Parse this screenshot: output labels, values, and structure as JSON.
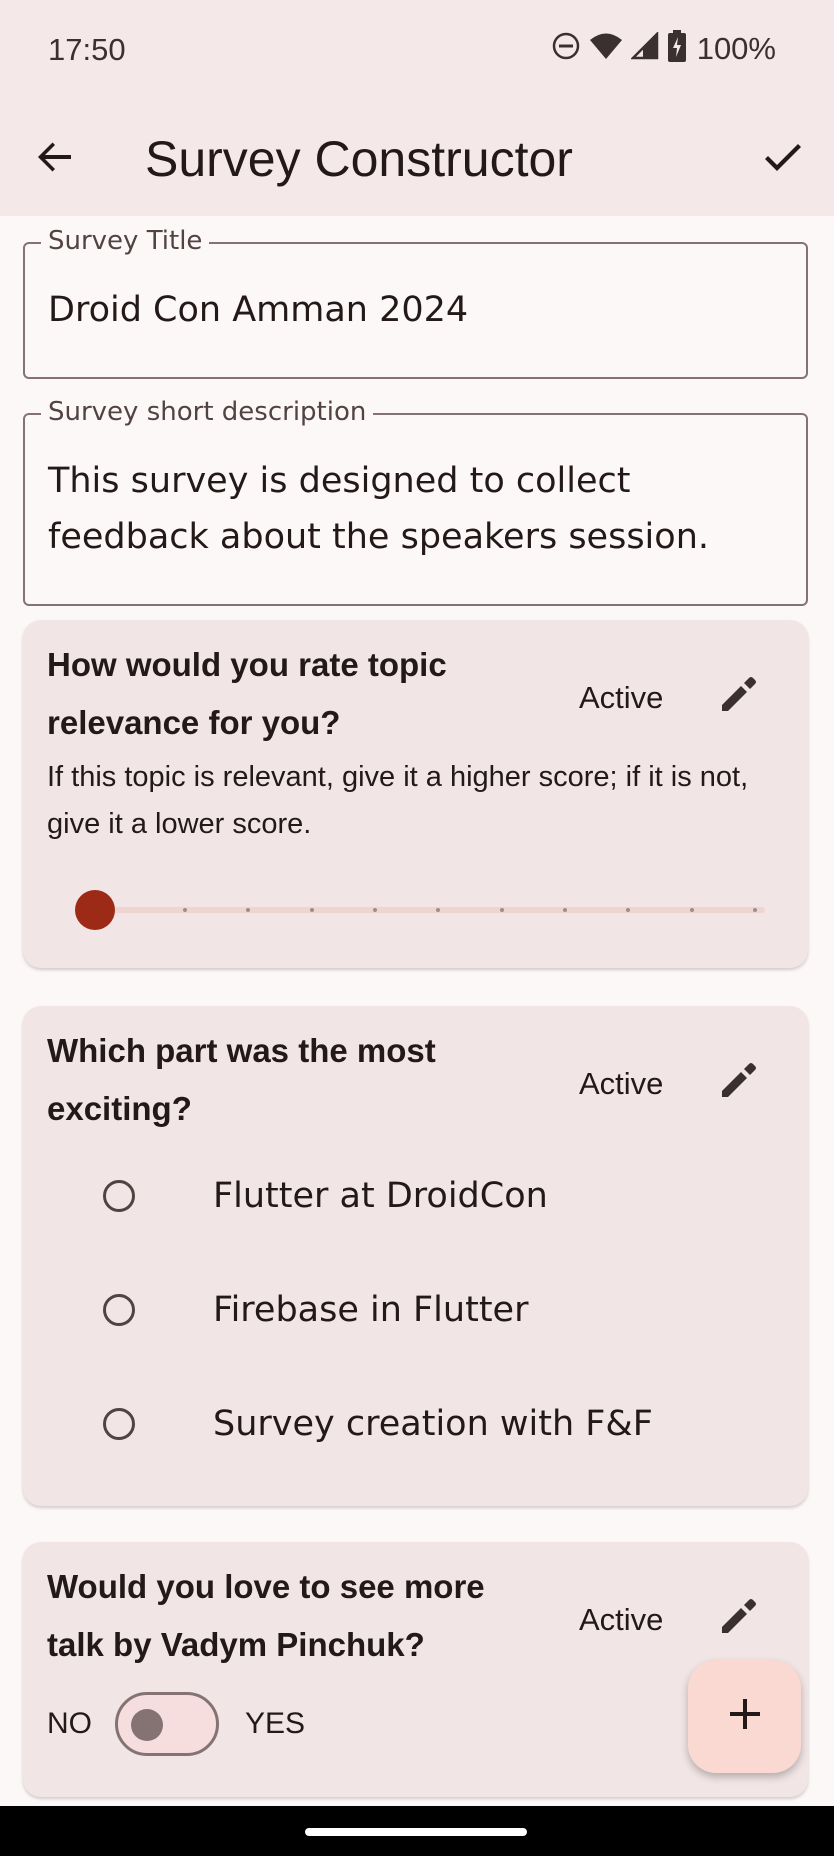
{
  "status_bar": {
    "time": "17:50",
    "battery": "100%",
    "icons": [
      "do-not-disturb-icon",
      "wifi-icon",
      "signal-icon",
      "battery-charging-icon"
    ]
  },
  "app_bar": {
    "title": "Survey Constructor",
    "back_icon": "arrow-back-icon",
    "confirm_icon": "check-icon"
  },
  "form": {
    "title_label": "Survey Title",
    "title_value": "Droid Con Amman 2024",
    "description_label": "Survey short description",
    "description_value": "This survey is designed to collect feedback about the speakers session."
  },
  "questions": [
    {
      "type": "slider",
      "title": "How would you rate topic relevance for you?",
      "status": "Active",
      "description": "If this topic is relevant, give it a higher score; if it is not, give it a lower score.",
      "slider_value_fraction": 0,
      "slider_divisions": 10
    },
    {
      "type": "single-choice",
      "title": "Which part was the most exciting?",
      "status": "Active",
      "options": [
        "Flutter at DroidCon",
        "Firebase in Flutter",
        "Survey creation with F&F"
      ]
    },
    {
      "type": "yes-no",
      "title": "Would you love to see more talk by Vadym Pinchuk?",
      "status": "Active",
      "no_label": "NO",
      "yes_label": "YES",
      "toggle_on": false
    }
  ],
  "fab": {
    "icon": "plus-icon"
  },
  "colors": {
    "accent": "#9c2a17",
    "app_bar_bg": "#f5e8e8",
    "card_bg": "#f1e5e5",
    "fab_bg": "#f9d9d1"
  }
}
